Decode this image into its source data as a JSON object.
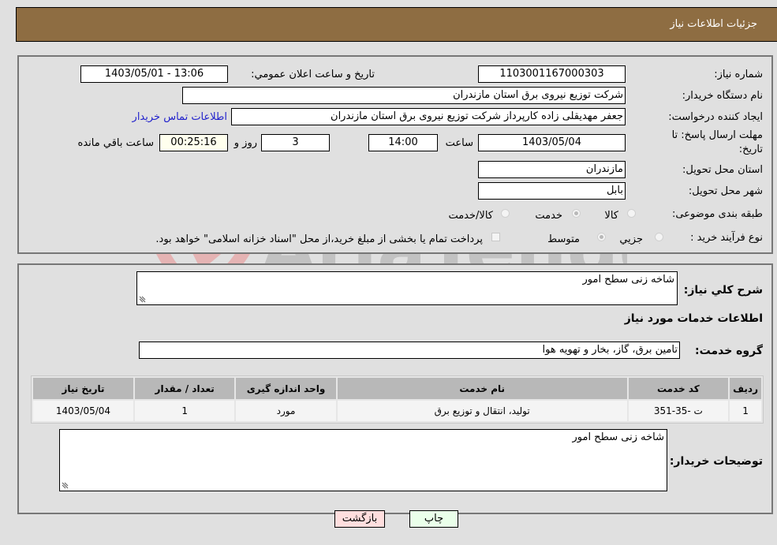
{
  "header": {
    "title": "جزئیات اطلاعات نیاز"
  },
  "form": {
    "need_number": {
      "label": "شماره نیاز:",
      "value": "1103001167000303"
    },
    "announce_datetime": {
      "label": "تاریخ و ساعت اعلان عمومي:",
      "value": "1403/05/01 - 13:06"
    },
    "buyer_org": {
      "label": "نام دستگاه خريدار:",
      "value": "شرکت توزیع نیروی برق استان مازندران"
    },
    "requester": {
      "label": "ایجاد کننده درخواست:",
      "value": "جعفر مهدیقلی زاده کارپرداز شرکت توزیع نیروی برق استان مازندران"
    },
    "buyer_contact_link": "اطلاعات تماس خريدار",
    "deadline": {
      "label_line1": "مهلت ارسال پاسخ: تا",
      "label_line2": "تاریخ:",
      "date": "1403/05/04",
      "time_label": "ساعت",
      "time": "14:00",
      "days": "3",
      "days_label": "روز و",
      "remaining": "00:25:16",
      "remaining_label": "ساعت باقي مانده"
    },
    "province": {
      "label": "استان محل تحویل:",
      "value": "مازندران"
    },
    "city": {
      "label": "شهر محل تحویل:",
      "value": "بابل"
    },
    "category": {
      "label": "طبقه بندی موضوعی:",
      "options": [
        "کالا",
        "خدمت",
        "کالا/خدمت"
      ],
      "selected": "خدمت"
    },
    "purchase_type": {
      "label": "نوع فرآیند خرید :",
      "options": [
        "جزيي",
        "متوسط"
      ],
      "selected": "متوسط",
      "treasury_note": "پرداخت تمام یا بخشی از مبلغ خرید،از محل \"اسناد خزانه اسلامی\" خواهد بود."
    }
  },
  "details": {
    "general_desc": {
      "label": "شرح کلي نياز:",
      "value": "شاخه زنی سطح امور"
    },
    "services_title": "اطلاعات خدمات مورد نياز",
    "service_group": {
      "label": "گروه خدمت:",
      "value": "تامین برق، گاز، بخار و تهویه هوا"
    },
    "table": {
      "headers": [
        "رديف",
        "کد خدمت",
        "نام خدمت",
        "واحد اندازه گيری",
        "تعداد / مقدار",
        "تاريخ نياز"
      ],
      "rows": [
        [
          "1",
          "ت -35-351",
          "تولید، انتقال و توزیع برق",
          "مورد",
          "1",
          "1403/05/04"
        ]
      ]
    },
    "buyer_notes": {
      "label": "توضيحات خريدار:",
      "value": "شاخه زنی سطح امور"
    }
  },
  "buttons": {
    "print": "چاپ",
    "back": "بازگشت"
  },
  "colors": {
    "header_bg": "#8e6d42",
    "print_bg": "#eaffea",
    "back_bg": "#ffdede",
    "remaining_bg": "#ffffee",
    "link": "#2222cc"
  },
  "watermark": "AriaTender.neT"
}
